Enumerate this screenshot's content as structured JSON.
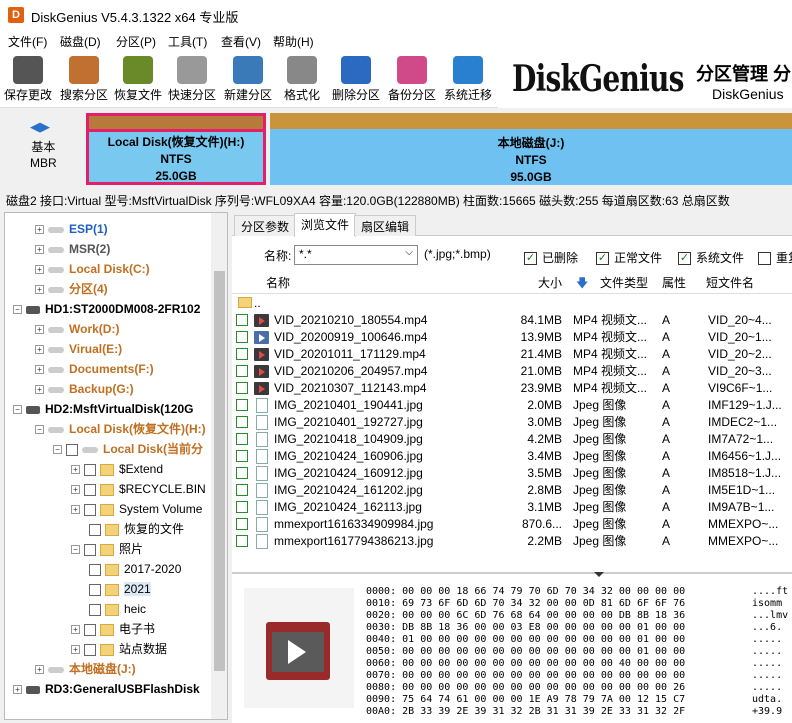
{
  "window": {
    "title": "DiskGenius V5.4.3.1322 x64 专业版",
    "logo": "D"
  },
  "menu": [
    "文件(F)",
    "磁盘(D)",
    "分区(P)",
    "工具(T)",
    "查看(V)",
    "帮助(H)"
  ],
  "toolbar": [
    {
      "label": "保存更改",
      "icon": "save-icon",
      "color": "#555"
    },
    {
      "label": "搜索分区",
      "icon": "search-icon",
      "color": "#c07030"
    },
    {
      "label": "恢复文件",
      "icon": "recover-icon",
      "color": "#6a8a2a"
    },
    {
      "label": "快速分区",
      "icon": "quick-partition-icon",
      "color": "#999"
    },
    {
      "label": "新建分区",
      "icon": "new-partition-icon",
      "color": "#3a7ab8"
    },
    {
      "label": "格式化",
      "icon": "format-icon",
      "color": "#888"
    },
    {
      "label": "删除分区",
      "icon": "delete-icon",
      "color": "#2a6ac0"
    },
    {
      "label": "备份分区",
      "icon": "backup-icon",
      "color": "#d04a8a"
    },
    {
      "label": "系统迁移",
      "icon": "migrate-icon",
      "color": "#2a80d0"
    }
  ],
  "banner": {
    "logo": "DiskGenius",
    "cn": "分区管理 分",
    "en": "DiskGenius"
  },
  "diskmap": {
    "nav": "◀▶",
    "label1": "基本",
    "label2": "MBR",
    "p1": {
      "name": "Local Disk(恢复文件)(H:)",
      "fs": "NTFS",
      "size": "25.0GB"
    },
    "p2": {
      "name": "本地磁盘(J:)",
      "fs": "NTFS",
      "size": "95.0GB"
    }
  },
  "infobar": "磁盘2 接口:Virtual  型号:MsftVirtualDisk  序列号:WFL09XA4  容量:120.0GB(122880MB)  柱面数:15665  磁头数:255  每道扇区数:63  总扇区数",
  "tree": [
    {
      "t": "ESP(1)",
      "c": "blu"
    },
    {
      "t": "MSR(2)",
      "c": "gry"
    },
    {
      "t": "Local Disk(C:)",
      "c": "org"
    },
    {
      "t": "分区(4)",
      "c": "org"
    },
    {
      "t": "HD1:ST2000DM008-2FR102",
      "c": "blk"
    },
    {
      "t": "Work(D:)",
      "c": "org"
    },
    {
      "t": "Virual(E:)",
      "c": "org"
    },
    {
      "t": "Documents(F:)",
      "c": "org"
    },
    {
      "t": "Backup(G:)",
      "c": "org"
    },
    {
      "t": "HD2:MsftVirtualDisk(120G",
      "c": "blk"
    },
    {
      "t": "Local Disk(恢复文件)(H:)",
      "c": "org"
    },
    {
      "t": "Local Disk(当前分",
      "c": "org"
    },
    {
      "t": "$Extend",
      "c": ""
    },
    {
      "t": "$RECYCLE.BIN",
      "c": ""
    },
    {
      "t": "System Volume",
      "c": ""
    },
    {
      "t": "恢复的文件",
      "c": ""
    },
    {
      "t": "照片",
      "c": ""
    },
    {
      "t": "2017-2020",
      "c": ""
    },
    {
      "t": "2021",
      "c": ""
    },
    {
      "t": "heic",
      "c": ""
    },
    {
      "t": "电子书",
      "c": ""
    },
    {
      "t": "站点数据",
      "c": ""
    },
    {
      "t": "本地磁盘(J:)",
      "c": "org"
    },
    {
      "t": "RD3:GeneralUSBFlashDisk",
      "c": "blk"
    }
  ],
  "tabs": [
    "分区参数",
    "浏览文件",
    "扇区编辑"
  ],
  "filter": {
    "label": "名称:",
    "value": "*.*",
    "hint": "(*.jpg;*.bmp)",
    "checks": [
      "已删除",
      "正常文件",
      "系统文件",
      "重复"
    ]
  },
  "headers": {
    "name": "名称",
    "size": "大小",
    "type": "文件类型",
    "attr": "属性",
    "short": "短文件名"
  },
  "parent": "..",
  "files": [
    {
      "name": "VID_20210210_180554.mp4",
      "size": "84.1MB",
      "type": "MP4 视频文...",
      "attr": "A",
      "short": "VID_20~4...",
      "k": "v"
    },
    {
      "name": "VID_20200919_100646.mp4",
      "size": "13.9MB",
      "type": "MP4 视频文...",
      "attr": "A",
      "short": "VID_20~1...",
      "k": "vb"
    },
    {
      "name": "VID_20201011_171129.mp4",
      "size": "21.4MB",
      "type": "MP4 视频文...",
      "attr": "A",
      "short": "VID_20~2...",
      "k": "v"
    },
    {
      "name": "VID_20210206_204957.mp4",
      "size": "21.0MB",
      "type": "MP4 视频文...",
      "attr": "A",
      "short": "VID_20~3...",
      "k": "v"
    },
    {
      "name": "VID_20210307_112143.mp4",
      "size": "23.9MB",
      "type": "MP4 视频文...",
      "attr": "A",
      "short": "VI9C6F~1...",
      "k": "v"
    },
    {
      "name": "IMG_20210401_190441.jpg",
      "size": "2.0MB",
      "type": "Jpeg 图像",
      "attr": "A",
      "short": "IMF129~1.J...",
      "k": "j"
    },
    {
      "name": "IMG_20210401_192727.jpg",
      "size": "3.0MB",
      "type": "Jpeg 图像",
      "attr": "A",
      "short": "IMDEC2~1...",
      "k": "j"
    },
    {
      "name": "IMG_20210418_104909.jpg",
      "size": "4.2MB",
      "type": "Jpeg 图像",
      "attr": "A",
      "short": "IM7A72~1...",
      "k": "j"
    },
    {
      "name": "IMG_20210424_160906.jpg",
      "size": "3.4MB",
      "type": "Jpeg 图像",
      "attr": "A",
      "short": "IM6456~1.J...",
      "k": "j"
    },
    {
      "name": "IMG_20210424_160912.jpg",
      "size": "3.5MB",
      "type": "Jpeg 图像",
      "attr": "A",
      "short": "IM8518~1.J...",
      "k": "j"
    },
    {
      "name": "IMG_20210424_161202.jpg",
      "size": "2.8MB",
      "type": "Jpeg 图像",
      "attr": "A",
      "short": "IM5E1D~1...",
      "k": "j"
    },
    {
      "name": "IMG_20210424_162113.jpg",
      "size": "3.1MB",
      "type": "Jpeg 图像",
      "attr": "A",
      "short": "IM9A7B~1...",
      "k": "j"
    },
    {
      "name": "mmexport1616334909984.jpg",
      "size": "870.6...",
      "type": "Jpeg 图像",
      "attr": "A",
      "short": "MMEXPO~...",
      "k": "j"
    },
    {
      "name": "mmexport1617794386213.jpg",
      "size": "2.2MB",
      "type": "Jpeg 图像",
      "attr": "A",
      "short": "MMEXPO~...",
      "k": "j"
    }
  ],
  "hex": [
    {
      "off": "0000:",
      "bytes": "00 00 00 18 66 74 79 70 6D 70 34 32 00 00 00 00",
      "asc": "....ft"
    },
    {
      "off": "0010:",
      "bytes": "69 73 6F 6D 6D 70 34 32 00 00 0D 81 6D 6F 6F 76",
      "asc": "isomm"
    },
    {
      "off": "0020:",
      "bytes": "00 00 00 6C 6D 76 68 64 00 00 00 00 DB 8B 18 36",
      "asc": "...lmv"
    },
    {
      "off": "0030:",
      "bytes": "DB 8B 18 36 00 00 03 E8 00 00 00 00 00 01 00 00",
      "asc": "...6."
    },
    {
      "off": "0040:",
      "bytes": "01 00 00 00 00 00 00 00 00 00 00 00 00 01 00 00",
      "asc": "....."
    },
    {
      "off": "0050:",
      "bytes": "00 00 00 00 00 00 00 00 00 00 00 00 00 01 00 00",
      "asc": "....."
    },
    {
      "off": "0060:",
      "bytes": "00 00 00 00 00 00 00 00 00 00 00 00 40 00 00 00",
      "asc": "....."
    },
    {
      "off": "0070:",
      "bytes": "00 00 00 00 00 00 00 00 00 00 00 00 00 00 00 00",
      "asc": "....."
    },
    {
      "off": "0080:",
      "bytes": "00 00 00 00 00 00 00 00 00 00 00 00 00 00 00 26",
      "asc": "....."
    },
    {
      "off": "0090:",
      "bytes": "75 64 74 61 00 00 00 1E A9 78 79 7A 00 12 15 C7",
      "asc": "udta."
    },
    {
      "off": "00A0:",
      "bytes": "2B 33 39 2E 39 31 32 2B 31 31 39 2E 33 31 32 2F",
      "asc": "+39.9"
    }
  ]
}
